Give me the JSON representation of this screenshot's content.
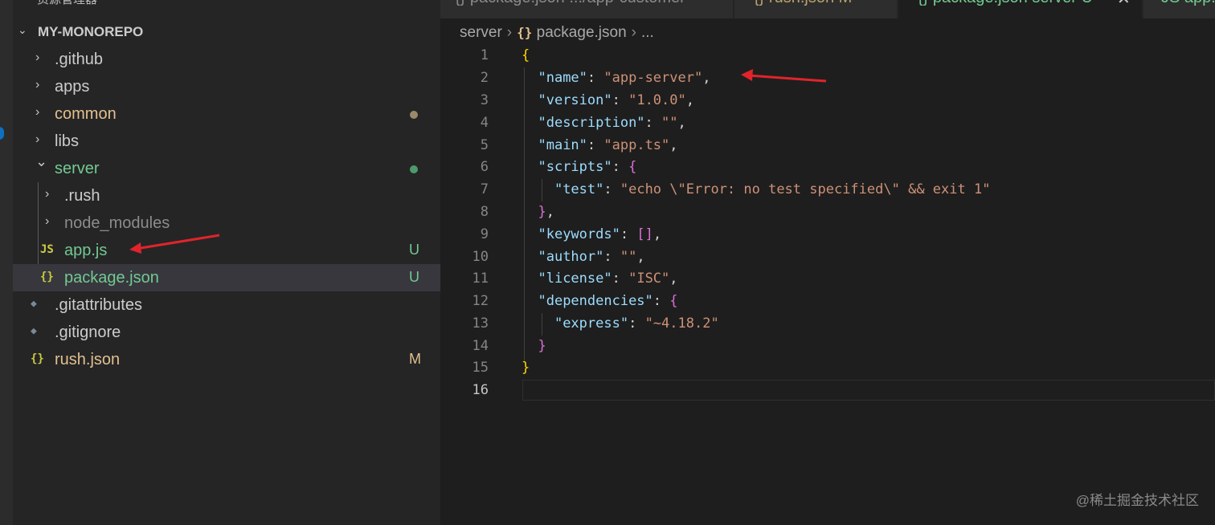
{
  "explorer": {
    "title": "资源管理器",
    "root_label": "MY-MONOREPO",
    "items": [
      {
        "label": ".github",
        "kind": "folder",
        "expanded": false,
        "color": "#cccccc"
      },
      {
        "label": "apps",
        "kind": "folder",
        "expanded": false,
        "color": "#cccccc"
      },
      {
        "label": "common",
        "kind": "folder",
        "expanded": false,
        "color": "#e2c08d",
        "status": "dot"
      },
      {
        "label": "libs",
        "kind": "folder",
        "expanded": false,
        "color": "#cccccc"
      },
      {
        "label": "server",
        "kind": "folder",
        "expanded": true,
        "color": "#73c991",
        "status": "dot"
      },
      {
        "label": ".rush",
        "kind": "folder",
        "expanded": false,
        "color": "#cccccc"
      },
      {
        "label": "node_modules",
        "kind": "folder",
        "expanded": false,
        "color": "#8c8c8c"
      },
      {
        "label": "app.js",
        "kind": "js",
        "color": "#73c991",
        "status": "U",
        "icon": "JS"
      },
      {
        "label": "package.json",
        "kind": "json",
        "color": "#73c991",
        "status": "U",
        "icon": "{}"
      },
      {
        "label": ".gitattributes",
        "kind": "git",
        "color": "#cccccc"
      },
      {
        "label": ".gitignore",
        "kind": "git",
        "color": "#cccccc"
      },
      {
        "label": "rush.json",
        "kind": "json",
        "color": "#e2c08d",
        "status": "M",
        "icon": "{}"
      }
    ]
  },
  "tabs": [
    {
      "label": "{} package.json  .../app-customer"
    },
    {
      "label": "{} rush.json M"
    },
    {
      "label": "{} package.json  server U"
    },
    {
      "label": "JS app.js"
    }
  ],
  "breadcrumb": {
    "folder": "server",
    "icon": "{}",
    "file": "package.json",
    "tail": "..."
  },
  "code_lines": [
    "1",
    "2",
    "3",
    "4",
    "5",
    "6",
    "7",
    "8",
    "9",
    "10",
    "11",
    "12",
    "13",
    "14",
    "15",
    "16"
  ],
  "code": {
    "name_key": "\"name\"",
    "name_val": "\"app-server\"",
    "version_key": "\"version\"",
    "version_val": "\"1.0.0\"",
    "description_key": "\"description\"",
    "description_val": "\"\"",
    "main_key": "\"main\"",
    "main_val": "\"app.ts\"",
    "scripts_key": "\"scripts\"",
    "test_key": "\"test\"",
    "test_val": "\"echo \\\"Error: no test specified\\\" && exit 1\"",
    "keywords_key": "\"keywords\"",
    "keywords_val": "[]",
    "author_key": "\"author\"",
    "author_val": "\"\"",
    "license_key": "\"license\"",
    "license_val": "\"ISC\"",
    "dependencies_key": "\"dependencies\"",
    "express_key": "\"express\"",
    "express_val": "\"~4.18.2\""
  },
  "watermark": "@稀土掘金技术社区",
  "colors": {
    "annotation_arrow": "#e0242a",
    "git_added": "#73c991",
    "git_modified": "#e2c08d"
  }
}
